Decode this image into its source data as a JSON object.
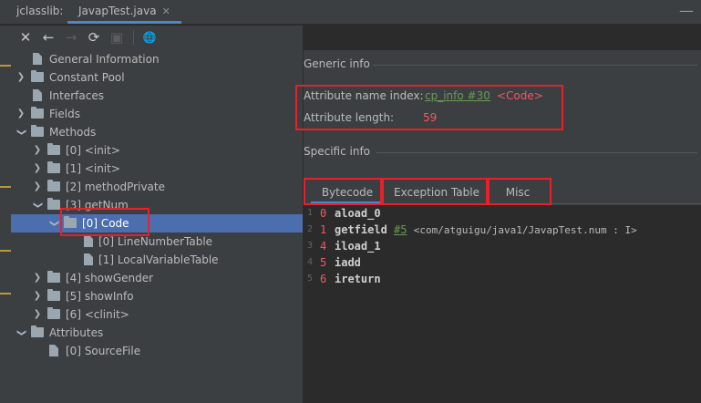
{
  "window": {
    "tool_title": "jclasslib:",
    "file_tab": "JavapTest.java",
    "close_glyph": "✕",
    "minimize_glyph": "—"
  },
  "toolbar": {
    "close": "✕",
    "back": "←",
    "forward": "→",
    "refresh": "⟳",
    "save": "▣",
    "web": "🌐"
  },
  "tree": {
    "items": [
      {
        "label": "General Information"
      },
      {
        "label": "Constant Pool"
      },
      {
        "label": "Interfaces"
      },
      {
        "label": "Fields"
      },
      {
        "label": "Methods"
      },
      {
        "label": "[0] <init>"
      },
      {
        "label": "[1] <init>"
      },
      {
        "label": "[2] methodPrivate"
      },
      {
        "label": "[3] getNum"
      },
      {
        "label": "[0] Code"
      },
      {
        "label": "[0] LineNumberTable"
      },
      {
        "label": "[1] LocalVariableTable"
      },
      {
        "label": "[4] showGender"
      },
      {
        "label": "[5] showInfo"
      },
      {
        "label": "[6] <clinit>"
      },
      {
        "label": "Attributes"
      },
      {
        "label": "[0] SourceFile"
      }
    ]
  },
  "detail": {
    "generic_title": "Generic info",
    "name_index_label": "Attribute name index:",
    "name_index_link": "cp_info #30",
    "name_index_value": "<Code>",
    "length_label": "Attribute length:",
    "length_value": "59",
    "specific_title": "Specific info",
    "tabs": [
      {
        "label": "Bytecode"
      },
      {
        "label": "Exception Table"
      },
      {
        "label": "Misc"
      }
    ],
    "code": [
      {
        "line": "1",
        "offset": "0",
        "op": "aload_0",
        "ref": "",
        "comment": ""
      },
      {
        "line": "2",
        "offset": "1",
        "op": "getfield",
        "ref": "#5",
        "comment": "<com/atguigu/java1/JavapTest.num : I>"
      },
      {
        "line": "3",
        "offset": "4",
        "op": "iload_1",
        "ref": "",
        "comment": ""
      },
      {
        "line": "4",
        "offset": "5",
        "op": "iadd",
        "ref": "",
        "comment": ""
      },
      {
        "line": "5",
        "offset": "6",
        "op": "ireturn",
        "ref": "",
        "comment": ""
      }
    ]
  },
  "colors": {
    "selection": "#4b6eaf",
    "annotation_red": "#e8202a",
    "accent_blue": "#4a88c7"
  }
}
